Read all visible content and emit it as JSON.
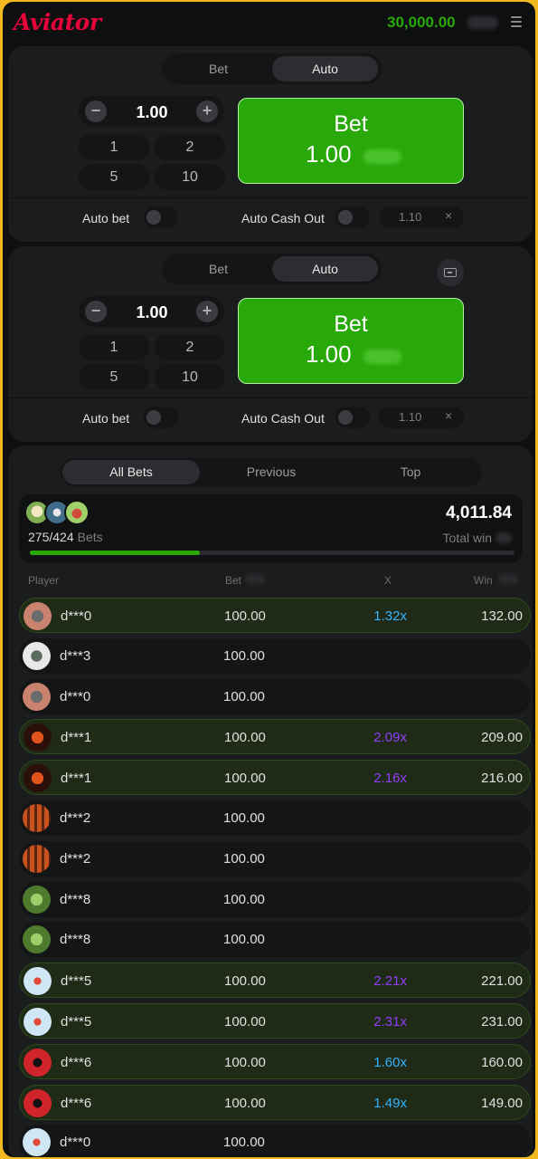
{
  "header": {
    "logo": "Aviator",
    "balance": "30,000.00",
    "menu_icon": "hamburger-menu-icon"
  },
  "colors": {
    "accent_green": "#28a909",
    "logo_red": "#e50539",
    "mult_blue": "#34b4ff",
    "mult_purple": "#913ef8"
  },
  "panels": [
    {
      "tabs": [
        "Bet",
        "Auto"
      ],
      "active_tab": "Auto",
      "amount": "1.00",
      "quick_amounts": [
        "1",
        "2",
        "5",
        "10"
      ],
      "bet_button": {
        "label": "Bet",
        "value": "1.00"
      },
      "auto_bet_label": "Auto bet",
      "auto_cashout_label": "Auto Cash Out",
      "cashout_value": "1.10",
      "clear": "×"
    },
    {
      "tabs": [
        "Bet",
        "Auto"
      ],
      "active_tab": "Auto",
      "amount": "1.00",
      "quick_amounts": [
        "1",
        "2",
        "5",
        "10"
      ],
      "bet_button": {
        "label": "Bet",
        "value": "1.00"
      },
      "auto_bet_label": "Auto bet",
      "auto_cashout_label": "Auto Cash Out",
      "cashout_value": "1.10",
      "clear": "×"
    }
  ],
  "bets": {
    "tabs": [
      "All Bets",
      "Previous",
      "Top"
    ],
    "active_tab": "All Bets",
    "count": "275/424",
    "count_label": "Bets",
    "total_win": "4,011.84",
    "total_win_label": "Total win",
    "progress": 0.35,
    "columns": {
      "player": "Player",
      "bet": "Bet",
      "x": "X",
      "win": "Win"
    },
    "rows": [
      {
        "player": "d***0",
        "bet": "100.00",
        "mult": "1.32x",
        "mult_color": "blue",
        "win": "132.00",
        "won": true
      },
      {
        "player": "d***3",
        "bet": "100.00",
        "mult": "",
        "mult_color": "",
        "win": "",
        "won": false
      },
      {
        "player": "d***0",
        "bet": "100.00",
        "mult": "",
        "mult_color": "",
        "win": "",
        "won": false
      },
      {
        "player": "d***1",
        "bet": "100.00",
        "mult": "2.09x",
        "mult_color": "purple",
        "win": "209.00",
        "won": true
      },
      {
        "player": "d***1",
        "bet": "100.00",
        "mult": "2.16x",
        "mult_color": "purple",
        "win": "216.00",
        "won": true
      },
      {
        "player": "d***2",
        "bet": "100.00",
        "mult": "",
        "mult_color": "",
        "win": "",
        "won": false
      },
      {
        "player": "d***2",
        "bet": "100.00",
        "mult": "",
        "mult_color": "",
        "win": "",
        "won": false
      },
      {
        "player": "d***8",
        "bet": "100.00",
        "mult": "",
        "mult_color": "",
        "win": "",
        "won": false
      },
      {
        "player": "d***8",
        "bet": "100.00",
        "mult": "",
        "mult_color": "",
        "win": "",
        "won": false
      },
      {
        "player": "d***5",
        "bet": "100.00",
        "mult": "2.21x",
        "mult_color": "purple",
        "win": "221.00",
        "won": true
      },
      {
        "player": "d***5",
        "bet": "100.00",
        "mult": "2.31x",
        "mult_color": "purple",
        "win": "231.00",
        "won": true
      },
      {
        "player": "d***6",
        "bet": "100.00",
        "mult": "1.60x",
        "mult_color": "blue",
        "win": "160.00",
        "won": true
      },
      {
        "player": "d***6",
        "bet": "100.00",
        "mult": "1.49x",
        "mult_color": "blue",
        "win": "149.00",
        "won": true
      },
      {
        "player": "d***0",
        "bet": "100.00",
        "mult": "",
        "mult_color": "",
        "win": "",
        "won": false
      }
    ]
  }
}
